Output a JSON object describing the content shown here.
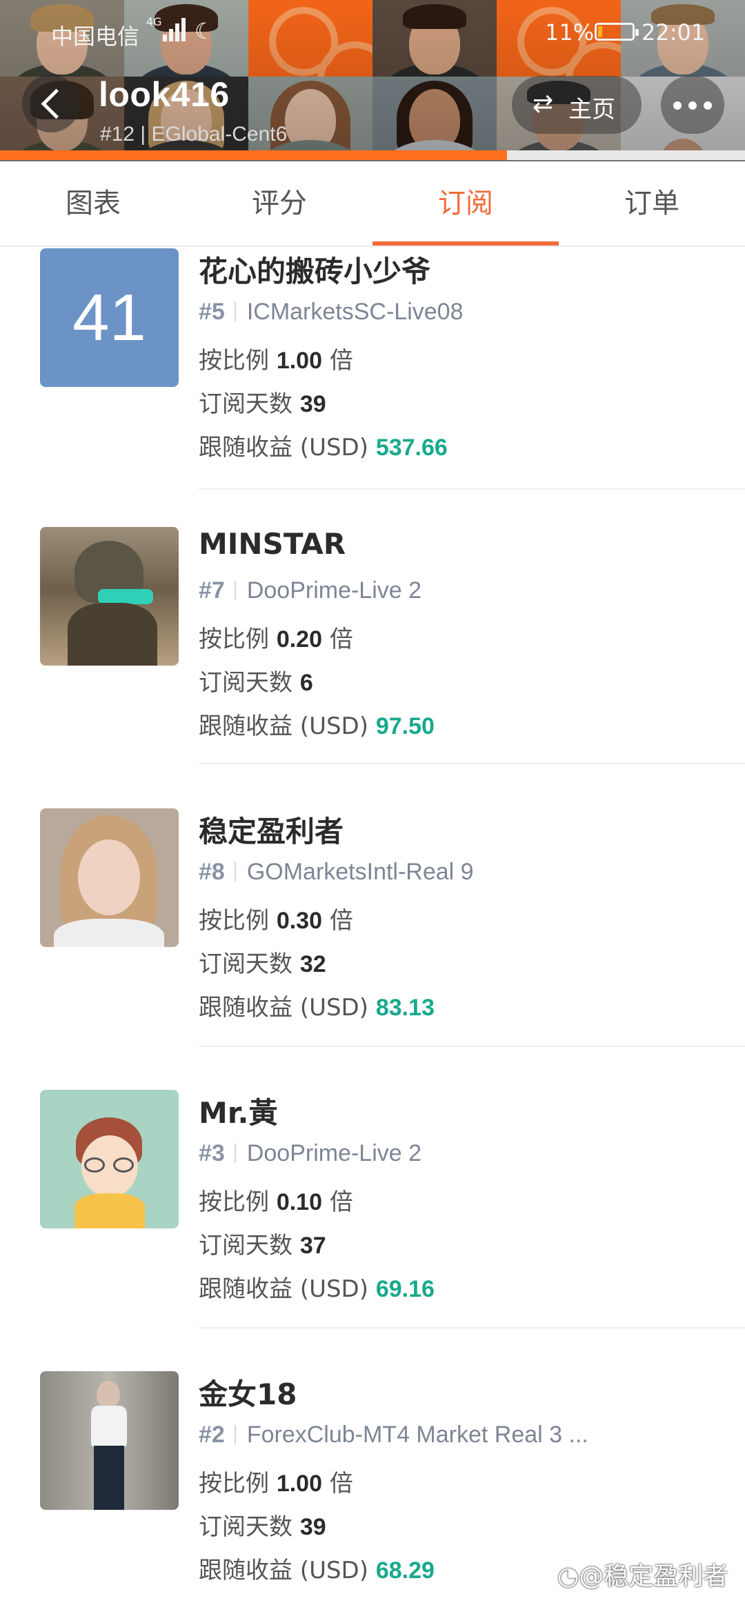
{
  "status_bar": {
    "carrier": "中国电信",
    "network": "4G",
    "battery": "11%",
    "time": "22:01"
  },
  "header": {
    "username": "look416",
    "subtitle": "#12 | EGlobal-Cent6",
    "home_label": "主页"
  },
  "tabs": [
    {
      "label": "图表",
      "active": false
    },
    {
      "label": "评分",
      "active": false
    },
    {
      "label": "订阅",
      "active": true
    },
    {
      "label": "订单",
      "active": false
    }
  ],
  "labels": {
    "ratio_prefix": "按比例",
    "ratio_suffix": "倍",
    "days_label": "订阅天数",
    "profit_label": "跟随收益 (USD)"
  },
  "items": [
    {
      "avatar_text": "41",
      "name": "花心的搬砖小少爷",
      "rank": "#5",
      "server": "ICMarketsSC-Live08",
      "ratio": "1.00",
      "days": "39",
      "profit": "537.66"
    },
    {
      "avatar_text": "",
      "name": "MINSTAR",
      "rank": "#7",
      "server": "DooPrime-Live 2",
      "ratio": "0.20",
      "days": "6",
      "profit": "97.50"
    },
    {
      "avatar_text": "",
      "name": "稳定盈利者",
      "rank": "#8",
      "server": "GOMarketsIntl-Real 9",
      "ratio": "0.30",
      "days": "32",
      "profit": "83.13"
    },
    {
      "avatar_text": "",
      "name": "Mr.黃",
      "rank": "#3",
      "server": "DooPrime-Live 2",
      "ratio": "0.10",
      "days": "37",
      "profit": "69.16"
    },
    {
      "avatar_text": "",
      "name": "金女18",
      "rank": "#2",
      "server": "ForexClub-MT4 Market Real 3 ...",
      "ratio": "1.00",
      "days": "39",
      "profit": "68.29"
    }
  ],
  "watermark": "稳定盈利者",
  "colors": {
    "accent": "#f26b3a",
    "header_orange": "#ff6f1d",
    "profit_green": "#19a98d",
    "avatar_blue": "#6b93c6"
  }
}
